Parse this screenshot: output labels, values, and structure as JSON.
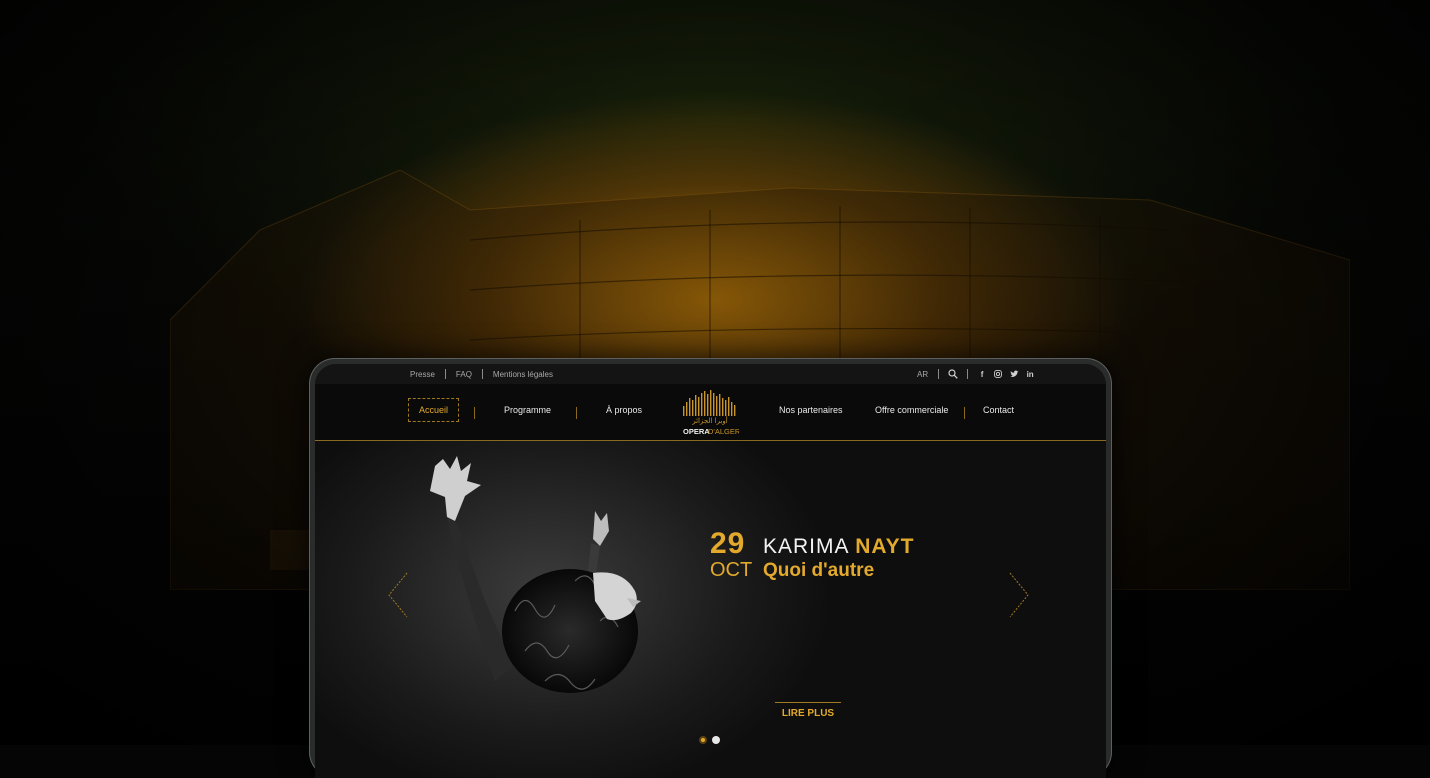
{
  "topbar": {
    "links": [
      "Presse",
      "FAQ",
      "Mentions légales"
    ],
    "lang": "AR",
    "social_icons": [
      "facebook-icon",
      "instagram-icon",
      "twitter-icon",
      "linkedin-icon"
    ]
  },
  "nav": {
    "items": [
      "Accueil",
      "Programme",
      "À propos",
      "Nos partenaires",
      "Offre commerciale",
      "Contact"
    ],
    "active": "Accueil"
  },
  "logo": {
    "arabic": "أوبرا الجزائر",
    "text_main": "OPERA",
    "text_sub": "D'ALGER"
  },
  "hero": {
    "day": "29",
    "month": "OCT",
    "artist_first": "KARIMA",
    "artist_last": "NAYT",
    "subtitle": "Quoi d'autre",
    "cta": "LIRE PLUS",
    "slides": 2,
    "active_slide": 1
  },
  "colors": {
    "accent": "#e2a92c",
    "background": "#0d0d0d",
    "text": "#eaeaea"
  }
}
